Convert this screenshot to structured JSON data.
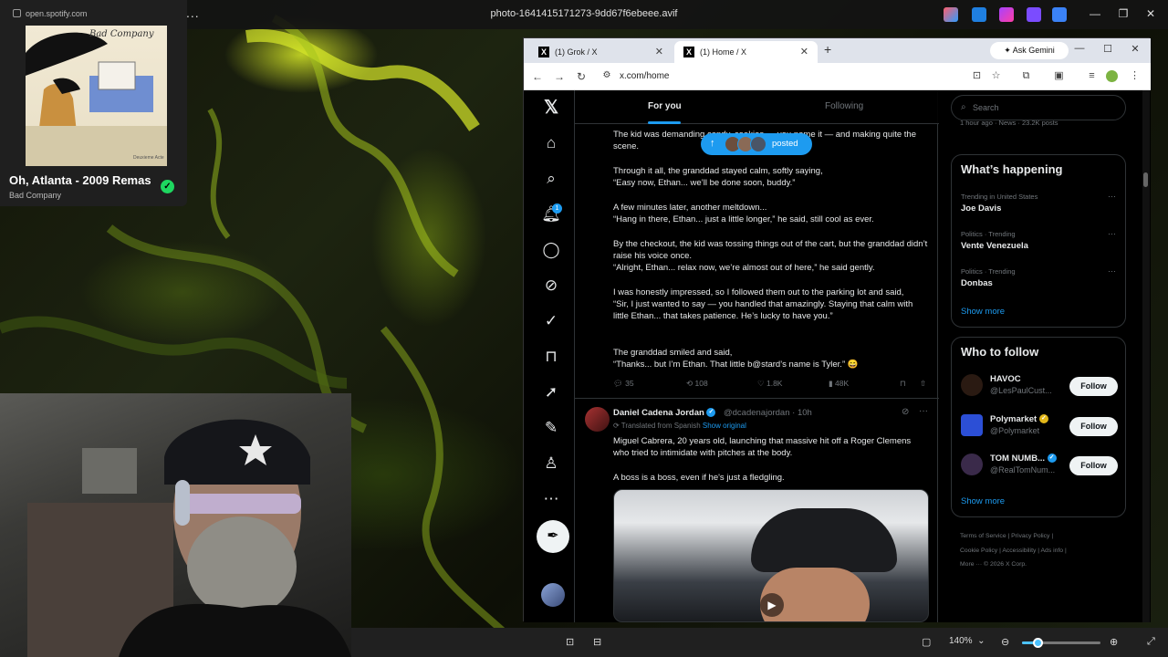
{
  "viewer": {
    "filename": "photo-1641415171273-9dd67f6ebeee.avif",
    "menu_dots": "...",
    "zoom_level": "140%",
    "zoom_dropdown": "⌄",
    "zoom_slider_fraction": 0.2
  },
  "spotify": {
    "url": "open.spotify.com",
    "album_title_art": "Bad Company",
    "album_subtitle_art": "Deuxieme Acte",
    "track": "Oh, Atlanta - 2009 Remaster",
    "artist": "Bad Company",
    "check": "✓"
  },
  "browser": {
    "tabs": [
      {
        "label": "(1) Grok / X",
        "close": "✕"
      },
      {
        "label": "(1) Home / X",
        "close": "✕"
      }
    ],
    "new_tab": "+",
    "gemini": "✦ Ask Gemini",
    "url": "x.com/home",
    "window": {
      "minimize": "—",
      "maximize": "☐",
      "close": "✕"
    }
  },
  "x": {
    "logo": "𝕏",
    "feed_tabs": {
      "for_you": "For you",
      "following": "Following"
    },
    "notif_count": "1",
    "posted_pill": "posted",
    "post1": {
      "lines": [
        "The kid was demanding candy, cookies — you name it — and making quite the scene.",
        "Through it all, the granddad stayed calm, softly saying,\n“Easy now, Ethan... we’ll be done soon, buddy.”",
        "A few minutes later, another meltdown...\n“Hang in there, Ethan... just a little longer,” he said, still cool as ever.",
        "By the checkout, the kid was tossing things out of the cart, but the granddad didn’t raise his voice once.\n“Alright, Ethan... relax now, we’re almost out of here,” he said gently.",
        "I was honestly impressed, so I followed them out to the parking lot and said,\n“Sir, I just wanted to say — you handled that amazingly. Staying that calm with little Ethan... that takes patience. He’s lucky to have you.”",
        "The granddad smiled and said,\n“Thanks... but I’m Ethan. That little b@stard’s name is Tyler.” 😄"
      ],
      "replies": "35",
      "reposts": "108",
      "likes": "1.8K",
      "views": "48K"
    },
    "post2": {
      "name": "Daniel Cadena Jordan",
      "handle": "@dcadenajordan · 10h",
      "translated": "Translated from Spanish",
      "show_original": "Show original",
      "text1": "Miguel Cabrera, 20 years old, launching that massive hit off a Roger Clemens who tried to intimidate with pitches at the body.",
      "text2": "A boss is a boss, even if he's just a fledgling.",
      "more": "···",
      "play": "▶"
    },
    "search_placeholder": "Search",
    "top_trend_meta": "1 hour ago · News · 23.2K posts",
    "whats_happening": {
      "title": "What’s happening",
      "trends": [
        {
          "meta": "Trending in United States",
          "name": "Joe Davis"
        },
        {
          "meta": "Politics · Trending",
          "name": "Vente Venezuela"
        },
        {
          "meta": "Politics · Trending",
          "name": "Donbas"
        }
      ],
      "more_dots": "···",
      "show_more": "Show more"
    },
    "who_to_follow": {
      "title": "Who to follow",
      "accounts": [
        {
          "name": "HAVOC",
          "handle": "@LesPaulCust...",
          "button": "Follow"
        },
        {
          "name": "Polymarket",
          "handle": "@Polymarket",
          "button": "Follow"
        },
        {
          "name": "TOM NUMB...",
          "handle": "@RealTomNum...",
          "button": "Follow"
        }
      ],
      "show_more": "Show more"
    },
    "footer": {
      "line1": "Terms of Service  |  Privacy Policy  |",
      "line2": "Cookie Policy  |  Accessibility  |  Ads info  |",
      "line3": "More ···   © 2026 X Corp."
    }
  },
  "colors": {
    "x_blue": "#1d9bf0",
    "spotify_green": "#1ed760",
    "x_bg": "#000000"
  }
}
